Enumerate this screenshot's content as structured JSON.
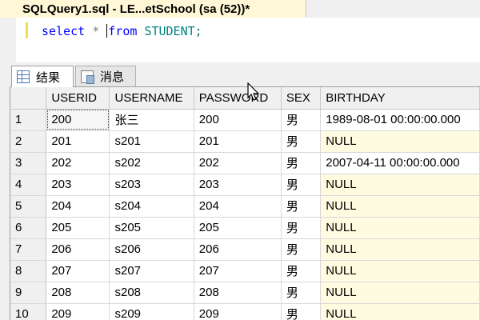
{
  "document_tab": {
    "title": "SQLQuery1.sql - LE...etSchool (sa (52))*"
  },
  "editor": {
    "kw_select": "select",
    "op_star": "*",
    "kw_from": "from",
    "table_name": "STUDENT;"
  },
  "result_tabs": [
    {
      "label": "结果",
      "icon": "grid-icon",
      "active": true
    },
    {
      "label": "消息",
      "icon": "messages-icon",
      "active": false
    }
  ],
  "grid": {
    "columns": [
      "USERID",
      "USERNAME",
      "PASSWORD",
      "SEX",
      "BIRTHDAY"
    ],
    "rows": [
      [
        "1",
        "200",
        "张三",
        "200",
        "男",
        "1989-08-01 00:00:00.000"
      ],
      [
        "2",
        "201",
        "s201",
        "201",
        "男",
        "NULL"
      ],
      [
        "3",
        "202",
        "s202",
        "202",
        "男",
        "2007-04-11 00:00:00.000"
      ],
      [
        "4",
        "203",
        "s203",
        "203",
        "男",
        "NULL"
      ],
      [
        "5",
        "204",
        "s204",
        "204",
        "男",
        "NULL"
      ],
      [
        "6",
        "205",
        "s205",
        "205",
        "男",
        "NULL"
      ],
      [
        "7",
        "206",
        "s206",
        "206",
        "男",
        "NULL"
      ],
      [
        "8",
        "207",
        "s207",
        "207",
        "男",
        "NULL"
      ],
      [
        "9",
        "208",
        "s208",
        "208",
        "男",
        "NULL"
      ],
      [
        "10",
        "209",
        "s209",
        "209",
        "男",
        "NULL"
      ]
    ]
  },
  "colors": {
    "null_cell": "#fffbe1",
    "keyword": "#0000ff",
    "identifier": "#008080",
    "tab_active": "#fff7d6"
  }
}
